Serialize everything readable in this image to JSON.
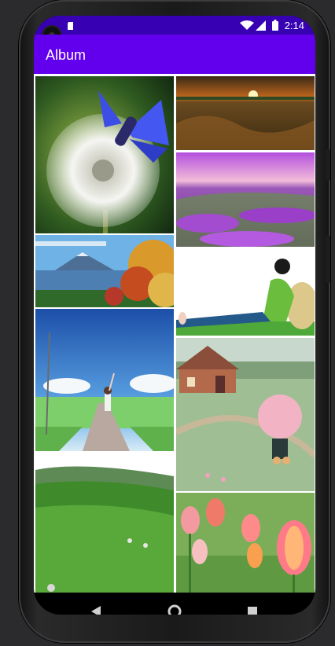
{
  "status_bar": {
    "time": "2:14",
    "icons": [
      "notification-icon",
      "sd-card-icon",
      "wifi-icon",
      "signal-icon",
      "battery-icon"
    ]
  },
  "app_bar": {
    "title": "Album"
  },
  "album": {
    "photos": [
      "butterfly-on-dandelion",
      "sunset-over-field",
      "lavender-field",
      "mount-fuji-lake",
      "girl-sitting-on-grass",
      "girl-in-field-raising-hand",
      "cottage-with-pink-umbrella",
      "green-grassland",
      "tulips"
    ]
  },
  "nav_bar": {
    "buttons": [
      "back-icon",
      "home-icon",
      "recents-icon"
    ]
  },
  "colors": {
    "status_bar": "#3700b3",
    "app_bar": "#6200ee",
    "grid_background": "#ffffff"
  }
}
